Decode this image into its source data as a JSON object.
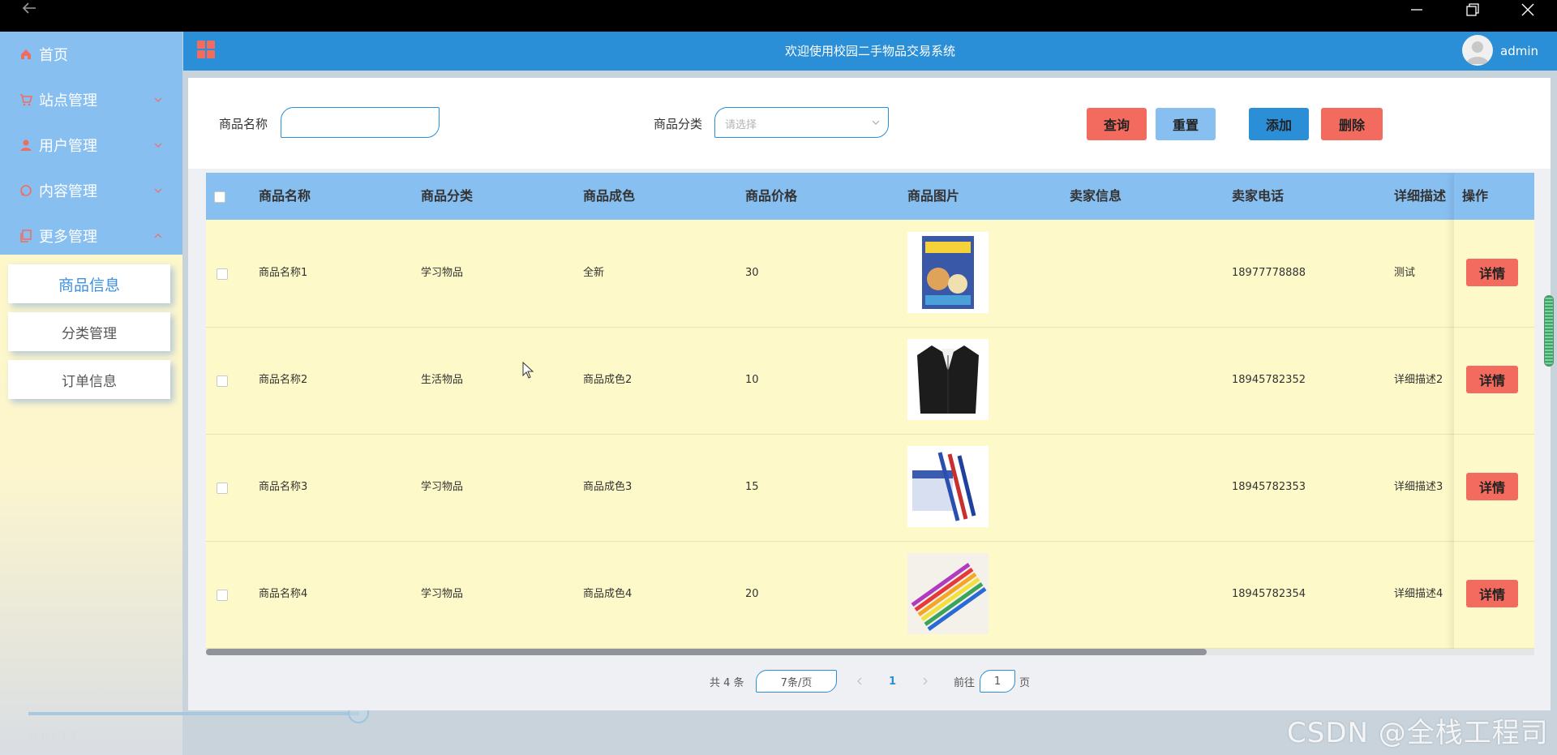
{
  "window": {
    "back_icon": "arrow-left-icon",
    "minimize_icon": "minimize-icon",
    "restore_icon": "restore-icon",
    "close_icon": "close-icon"
  },
  "sidebar": {
    "items": [
      {
        "label": "首页",
        "icon": "home-icon",
        "expandable": false,
        "expanded": false
      },
      {
        "label": "站点管理",
        "icon": "cart-icon",
        "expandable": true,
        "expanded": false
      },
      {
        "label": "用户管理",
        "icon": "user-icon",
        "expandable": true,
        "expanded": false
      },
      {
        "label": "内容管理",
        "icon": "chat-icon",
        "expandable": true,
        "expanded": false
      },
      {
        "label": "更多管理",
        "icon": "copy-icon",
        "expandable": true,
        "expanded": true
      }
    ],
    "submenu": [
      {
        "label": "商品信息",
        "active": true
      },
      {
        "label": "分类管理",
        "active": false
      },
      {
        "label": "订单信息",
        "active": false
      }
    ],
    "icon_color": "#f36b5e"
  },
  "header": {
    "title": "欢迎使用校园二手物品交易系统",
    "username": "admin",
    "background": "#2a8fd6"
  },
  "search": {
    "name_label": "商品名称",
    "name_value": "",
    "category_label": "商品分类",
    "category_placeholder": "请选择",
    "buttons": {
      "query": "查询",
      "reset": "重置",
      "add": "添加",
      "delete": "删除"
    },
    "button_colors": {
      "query": "#f36b5e",
      "reset": "#88bff1",
      "add": "#2a8fd6",
      "delete": "#f36b5e"
    }
  },
  "table": {
    "columns": [
      "商品名称",
      "商品分类",
      "商品成色",
      "商品价格",
      "商品图片",
      "卖家信息",
      "卖家电话",
      "详细描述",
      "操作"
    ],
    "header_background": "#88bff1",
    "row_background": "#fdf9c8",
    "detail_label": "详情",
    "rows": [
      {
        "name": "商品名称1",
        "category": "学习物品",
        "condition": "全新",
        "price": "30",
        "image": "book-cover-image",
        "seller": "",
        "phone": "18977778888",
        "desc": "测试"
      },
      {
        "name": "商品名称2",
        "category": "生活物品",
        "condition": "商品成色2",
        "price": "10",
        "image": "suit-jacket-image",
        "seller": "",
        "phone": "18945782352",
        "desc": "详细描述2"
      },
      {
        "name": "商品名称3",
        "category": "学习物品",
        "condition": "商品成色3",
        "price": "15",
        "image": "pens-image",
        "seller": "",
        "phone": "18945782353",
        "desc": "详细描述3"
      },
      {
        "name": "商品名称4",
        "category": "学习物品",
        "condition": "商品成色4",
        "price": "20",
        "image": "markers-image",
        "seller": "",
        "phone": "18945782354",
        "desc": "详细描述4"
      }
    ]
  },
  "pagination": {
    "total": "共 4 条",
    "page_size": "7条/页",
    "current_page": "1",
    "goto_label": "前往",
    "goto_value": "1",
    "page_suffix": "页"
  },
  "video": {
    "time": "0:02:13",
    "progress": 0.23
  },
  "watermark": "CSDN @全栈工程司"
}
